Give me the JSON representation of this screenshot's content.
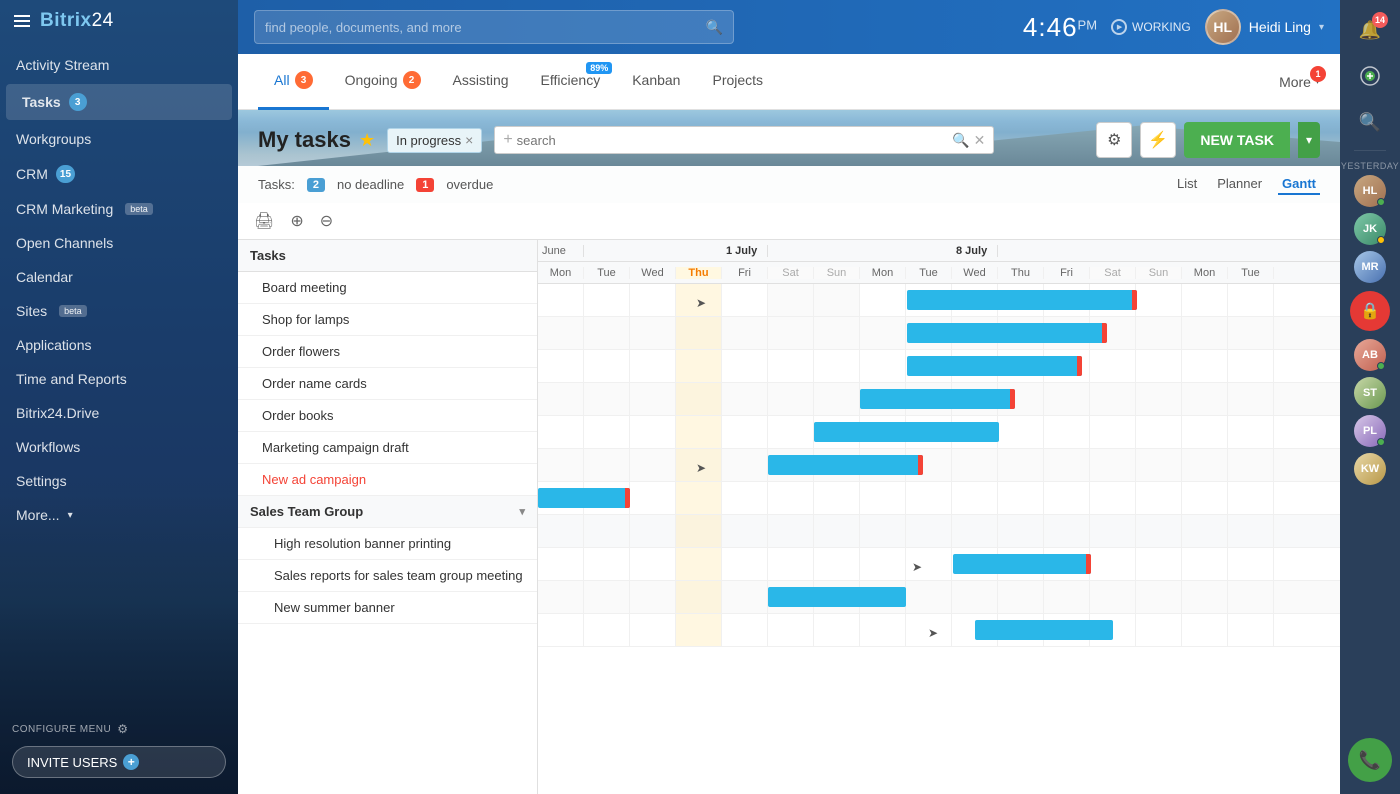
{
  "app": {
    "title": "Bitrix",
    "title2": "24"
  },
  "topbar": {
    "search_placeholder": "find people, documents, and more",
    "clock": "4:46",
    "clock_period": "PM",
    "status": "WORKING",
    "user_name": "Heidi Ling"
  },
  "sidebar": {
    "items": [
      {
        "label": "Activity Stream",
        "badge": null,
        "active": false
      },
      {
        "label": "Tasks",
        "badge": "3",
        "badge_type": "blue",
        "active": true
      },
      {
        "label": "Workgroups",
        "badge": null,
        "active": false
      },
      {
        "label": "CRM",
        "badge": "15",
        "badge_type": "blue",
        "active": false
      },
      {
        "label": "CRM Marketing",
        "badge": null,
        "beta": true,
        "active": false
      },
      {
        "label": "Open Channels",
        "badge": null,
        "active": false
      },
      {
        "label": "Calendar",
        "badge": null,
        "active": false
      },
      {
        "label": "Sites",
        "badge": null,
        "beta": true,
        "active": false
      },
      {
        "label": "Applications",
        "badge": null,
        "active": false
      },
      {
        "label": "Time and Reports",
        "badge": null,
        "active": false
      },
      {
        "label": "Bitrix24.Drive",
        "badge": null,
        "active": false
      },
      {
        "label": "Workflows",
        "badge": null,
        "active": false
      },
      {
        "label": "Settings",
        "badge": null,
        "active": false
      },
      {
        "label": "More...",
        "badge": null,
        "active": false
      }
    ],
    "configure_menu": "CONFIGURE MENU",
    "invite_users": "INVITE USERS"
  },
  "tabs": [
    {
      "label": "All",
      "badge": "3",
      "badge_type": "orange",
      "active": true
    },
    {
      "label": "Ongoing",
      "badge": "2",
      "badge_type": "orange"
    },
    {
      "label": "Assisting",
      "badge": null
    },
    {
      "label": "Efficiency",
      "badge": "89%",
      "badge_type": "blue_top"
    },
    {
      "label": "Kanban",
      "badge": null
    },
    {
      "label": "Projects",
      "badge": null
    }
  ],
  "tabs_more": "More",
  "tasks": {
    "title": "My tasks",
    "filter_tag": "In progress",
    "search_placeholder": "search",
    "info": {
      "tasks_label": "Tasks:",
      "no_deadline_count": "2",
      "no_deadline_label": "no deadline",
      "overdue_count": "1",
      "overdue_label": "overdue"
    },
    "new_task_label": "NEW TASK",
    "views": [
      "List",
      "Planner",
      "Gantt"
    ]
  },
  "gantt": {
    "dates": {
      "june_label": "June",
      "july1_label": "1 July",
      "july8_label": "8 July"
    },
    "days": [
      "Mon",
      "Tue",
      "Wed",
      "Thu",
      "Fri",
      "Sat",
      "Sun",
      "Mon",
      "Tue",
      "Wed",
      "Thu",
      "Fri",
      "Sat",
      "Sun",
      "Mon",
      "Tue"
    ],
    "task_list": [
      {
        "name": "Board meeting",
        "indent": 1
      },
      {
        "name": "Shop for lamps",
        "indent": 1
      },
      {
        "name": "Order flowers",
        "indent": 1
      },
      {
        "name": "Order name cards",
        "indent": 1
      },
      {
        "name": "Order books",
        "indent": 1
      },
      {
        "name": "Marketing campaign draft",
        "indent": 1
      },
      {
        "name": "New ad campaign",
        "indent": 1,
        "style": "red"
      },
      {
        "name": "Sales Team Group",
        "indent": 0,
        "is_group": true
      },
      {
        "name": "High resolution banner printing",
        "indent": 2
      },
      {
        "name": "Sales reports for sales team group meeting",
        "indent": 2
      },
      {
        "name": "New summer banner",
        "indent": 2
      }
    ]
  },
  "right_panel": {
    "notification_badge": "14",
    "yesterday_label": "Yesterday"
  }
}
